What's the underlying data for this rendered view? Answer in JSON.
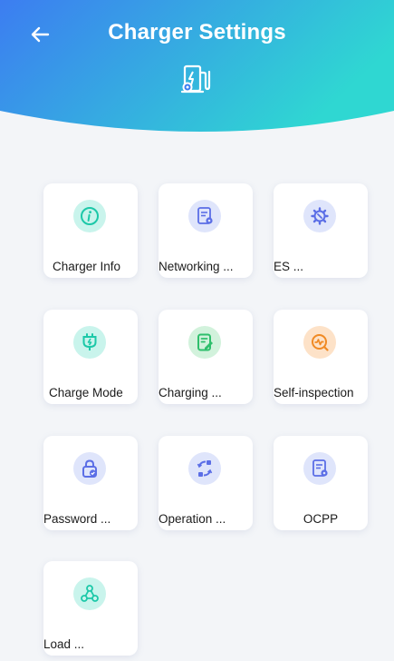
{
  "header": {
    "title": "Charger Settings",
    "icon": "charger-settings-icon",
    "gradient_from": "#3c7df1",
    "gradient_to": "#2fd7d2"
  },
  "tiles": [
    {
      "label": "Charger Info",
      "icon": "info-icon"
    },
    {
      "label": "Networking ...",
      "icon": "document-gear-icon"
    },
    {
      "label": "ES ...",
      "icon": "gear-wrench-icon"
    },
    {
      "label": "Charge Mode",
      "icon": "plug-bolt-icon"
    },
    {
      "label": "Charging ...",
      "icon": "edit-document-icon"
    },
    {
      "label": "Self-inspection",
      "icon": "wave-check-icon"
    },
    {
      "label": "Password ...",
      "icon": "lock-check-icon"
    },
    {
      "label": "Operation ...",
      "icon": "sync-icon"
    },
    {
      "label": "OCPP",
      "icon": "document-gear-icon"
    },
    {
      "label": "Load ...",
      "icon": "triangle-nodes-icon"
    }
  ]
}
